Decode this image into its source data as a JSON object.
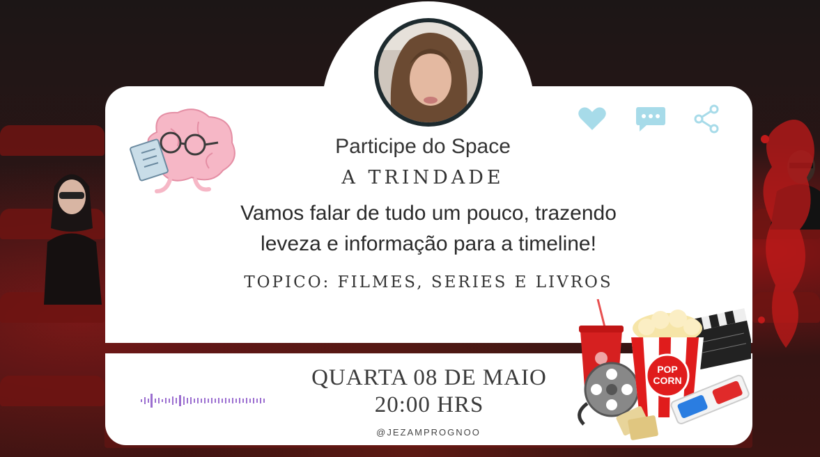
{
  "card": {
    "title": "Participe do Space",
    "space_name": "A TRINDADE",
    "description_line1": "Vamos falar de tudo um pouco, trazendo",
    "description_line2": "leveza e informação para a timeline!",
    "topic": "TOPICO: FILMES, SERIES E LIVROS"
  },
  "actions": {
    "like_icon": "heart-icon",
    "comment_icon": "comment-icon",
    "share_icon": "share-icon",
    "icon_color": "#a7dbe9"
  },
  "event": {
    "date": "QUARTA 08 DE MAIO",
    "time": "20:00 HRS",
    "handle": "@JEZAMPROGNOO"
  },
  "colors": {
    "card_bg": "#ffffff",
    "text": "#333333",
    "wave": "#9b6ed0",
    "seat_red": "#6e1412"
  }
}
